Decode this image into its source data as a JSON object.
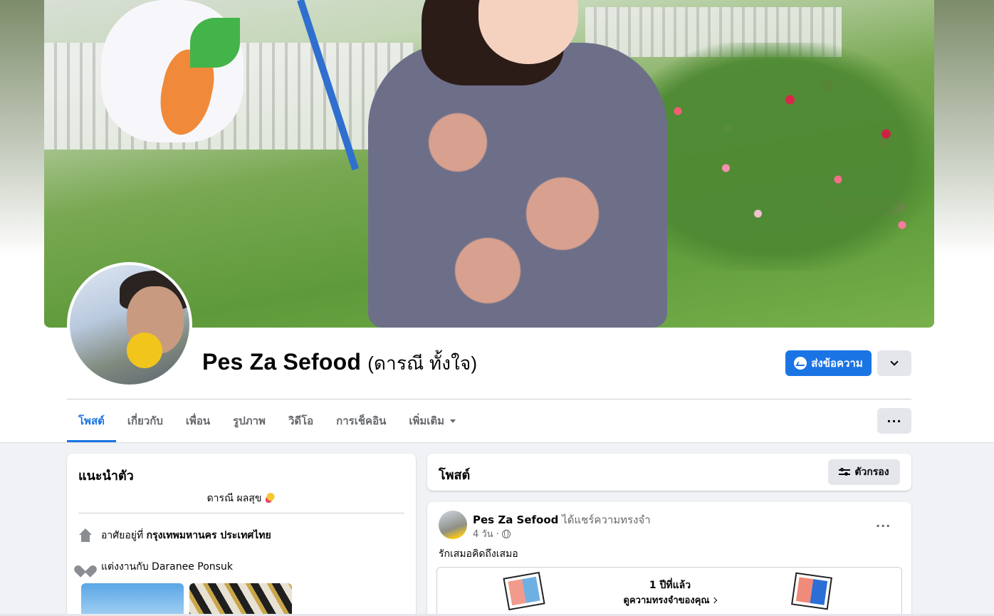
{
  "profile": {
    "name": "Pes Za Sefood",
    "alt_name": "(ดารณี ทั้งใจ)"
  },
  "actions": {
    "message_label": "ส่งข้อความ"
  },
  "tabs": [
    {
      "label": "โพสต์",
      "active": true
    },
    {
      "label": "เกี่ยวกับ",
      "active": false
    },
    {
      "label": "เพื่อน",
      "active": false
    },
    {
      "label": "รูปภาพ",
      "active": false
    },
    {
      "label": "วิดีโอ",
      "active": false
    },
    {
      "label": "การเช็คอิน",
      "active": false
    },
    {
      "label": "เพิ่มเติม",
      "active": false
    }
  ],
  "intro": {
    "title": "แนะนำตัว",
    "bio": "ดารณี ผลสุข",
    "lives_prefix": "อาศัยอยู่ที่",
    "lives_place": "กรุงเทพมหานคร ประเทศไทย",
    "married_prefix": "แต่งงานกับ",
    "married_name": "Daranee Ponsuk"
  },
  "posts_section": {
    "title": "โพสต์",
    "filter_label": "ตัวกรอง"
  },
  "post": {
    "author": "Pes Za Sefood",
    "action": "ได้แชร์ความทรงจำ",
    "time": "4 วัน ·",
    "text": "รักเสมอคิดถึงเสมอ",
    "memory_title": "1 ปีที่แล้ว",
    "memory_link": "ดูความทรงจำของคุณ"
  },
  "icons": {
    "messenger": "messenger-icon",
    "chevron": "chevron-down-icon",
    "more": "more-dots-icon",
    "home": "home-icon",
    "heart": "heart-icon",
    "globe": "globe-icon",
    "filter": "filter-sliders-icon"
  },
  "colors": {
    "accent": "#1b74e4",
    "muted_text": "#65676b",
    "button_gray": "#e4e6eb",
    "page_bg": "#f0f2f5"
  }
}
